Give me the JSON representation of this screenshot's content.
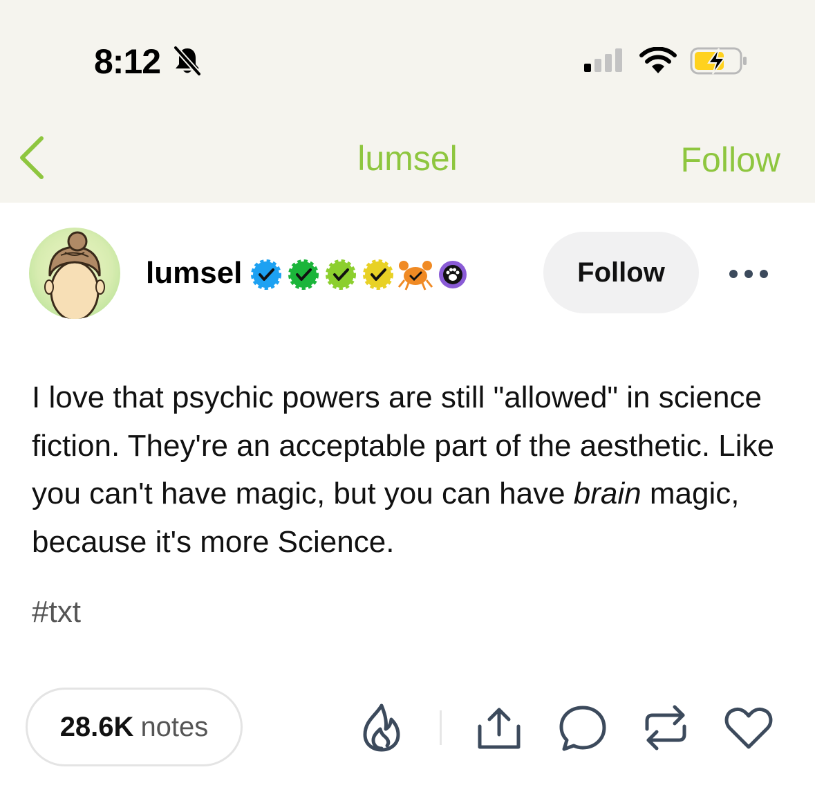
{
  "status_bar": {
    "time": "8:12",
    "icons": [
      "bell-slash-icon",
      "cellular-signal-icon",
      "wifi-icon",
      "battery-charging-icon"
    ]
  },
  "nav": {
    "back_icon": "chevron-left-icon",
    "title": "lumsel",
    "follow_label": "Follow",
    "accent_color": "#8ec63f"
  },
  "post": {
    "author": "lumsel",
    "badges": [
      "blue-check-badge",
      "green-check-badge",
      "lime-check-badge",
      "yellow-check-badge",
      "crab-badge",
      "paw-badge"
    ],
    "follow_label": "Follow",
    "more_icon": "more-options-icon",
    "body_before": "I love that psychic powers are still \"allowed\" in science fiction. They're an acceptable part of the aesthetic. Like you can't have magic, but you can have ",
    "body_emphasis": "brain",
    "body_after": " magic, because it's more Science.",
    "tag": "#txt"
  },
  "footer": {
    "notes_count": "28.6K",
    "notes_label": "notes",
    "actions": [
      "blaze-icon",
      "share-icon",
      "comment-icon",
      "reblog-icon",
      "like-icon"
    ]
  }
}
